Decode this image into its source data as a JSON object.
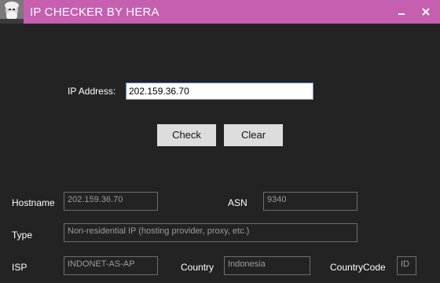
{
  "window": {
    "title": "IP CHECKER BY HERA",
    "minimize_glyph": "–",
    "close_glyph": "✕",
    "accent_color": "#c75fb1"
  },
  "form": {
    "ip_label": "IP Address:",
    "ip_value": "202.159.36.70",
    "check_label": "Check",
    "clear_label": "Clear"
  },
  "results": {
    "hostname_label": "Hostname",
    "hostname_value": "202.159.36.70",
    "asn_label": "ASN",
    "asn_value": "9340",
    "type_label": "Type",
    "type_value": "Non-residential IP (hosting provider, proxy, etc.)",
    "isp_label": "ISP",
    "isp_value": "INDONET-AS-AP",
    "country_label": "Country",
    "country_value": "Indonesia",
    "countrycode_label": "CountryCode",
    "countrycode_value": "ID"
  }
}
